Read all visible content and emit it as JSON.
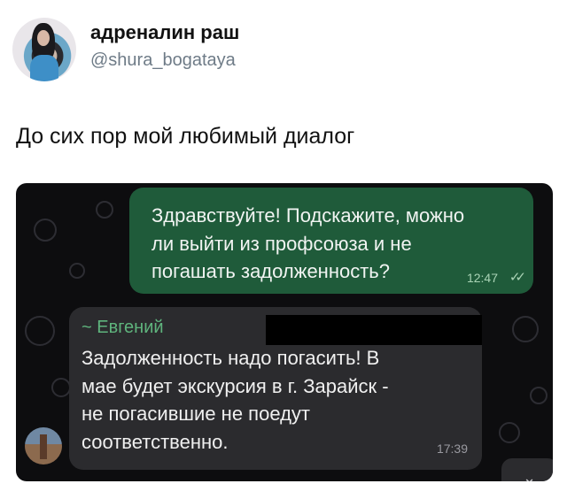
{
  "post": {
    "author_name": "адреналин раш",
    "author_handle": "@shura_bogataya",
    "text": "До сих пор мой любимый диалог"
  },
  "chat": {
    "outgoing": {
      "text": "Здравствуйте! Подскажите, можно\nли выйти из профсоюза и не\nпогашать задолженность?",
      "time": "12:47",
      "read_ticks": "✓✓"
    },
    "incoming": {
      "sender": "~ Евгений",
      "text": "Задолженность надо погасить! В\nмае будет экскурсия в г. Зарайск -\nне погасившие не поедут\nсоответственно.",
      "time": "17:39"
    }
  },
  "colors": {
    "outgoing_bubble": "#1f5b3a",
    "incoming_bubble": "#2b2b2e",
    "sender_name": "#5fb47d",
    "chat_bg": "#0d0d0f"
  },
  "icons": {
    "scroll_down": "chevron-down-icon"
  }
}
